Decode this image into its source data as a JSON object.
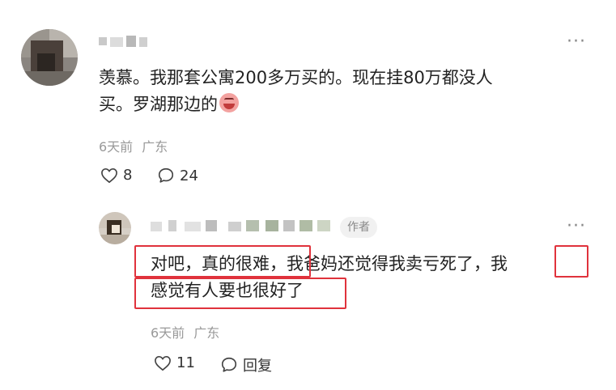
{
  "comment": {
    "text_line1": "羡慕。我那套公寓200多万买的。现在挂80万都没人",
    "text_line2": "买。罗湖那边的",
    "emoji_icon": "crying-face-icon",
    "time": "6天前",
    "location": "广东",
    "likes": "8",
    "replies": "24",
    "more_label": "···"
  },
  "reply": {
    "author_tag": "作者",
    "line1_part1": "对吧，真的很难，",
    "line1_part2": "我爸妈还觉得我卖亏死了，",
    "line1_part3": "我",
    "line2": "感觉有人要也很好了",
    "time": "6天前",
    "location": "广东",
    "likes": "11",
    "reply_label": "回复",
    "more_label": "···"
  },
  "colors": {
    "highlight": "#e0323c",
    "meta_text": "#999999",
    "body_text": "#222222"
  }
}
